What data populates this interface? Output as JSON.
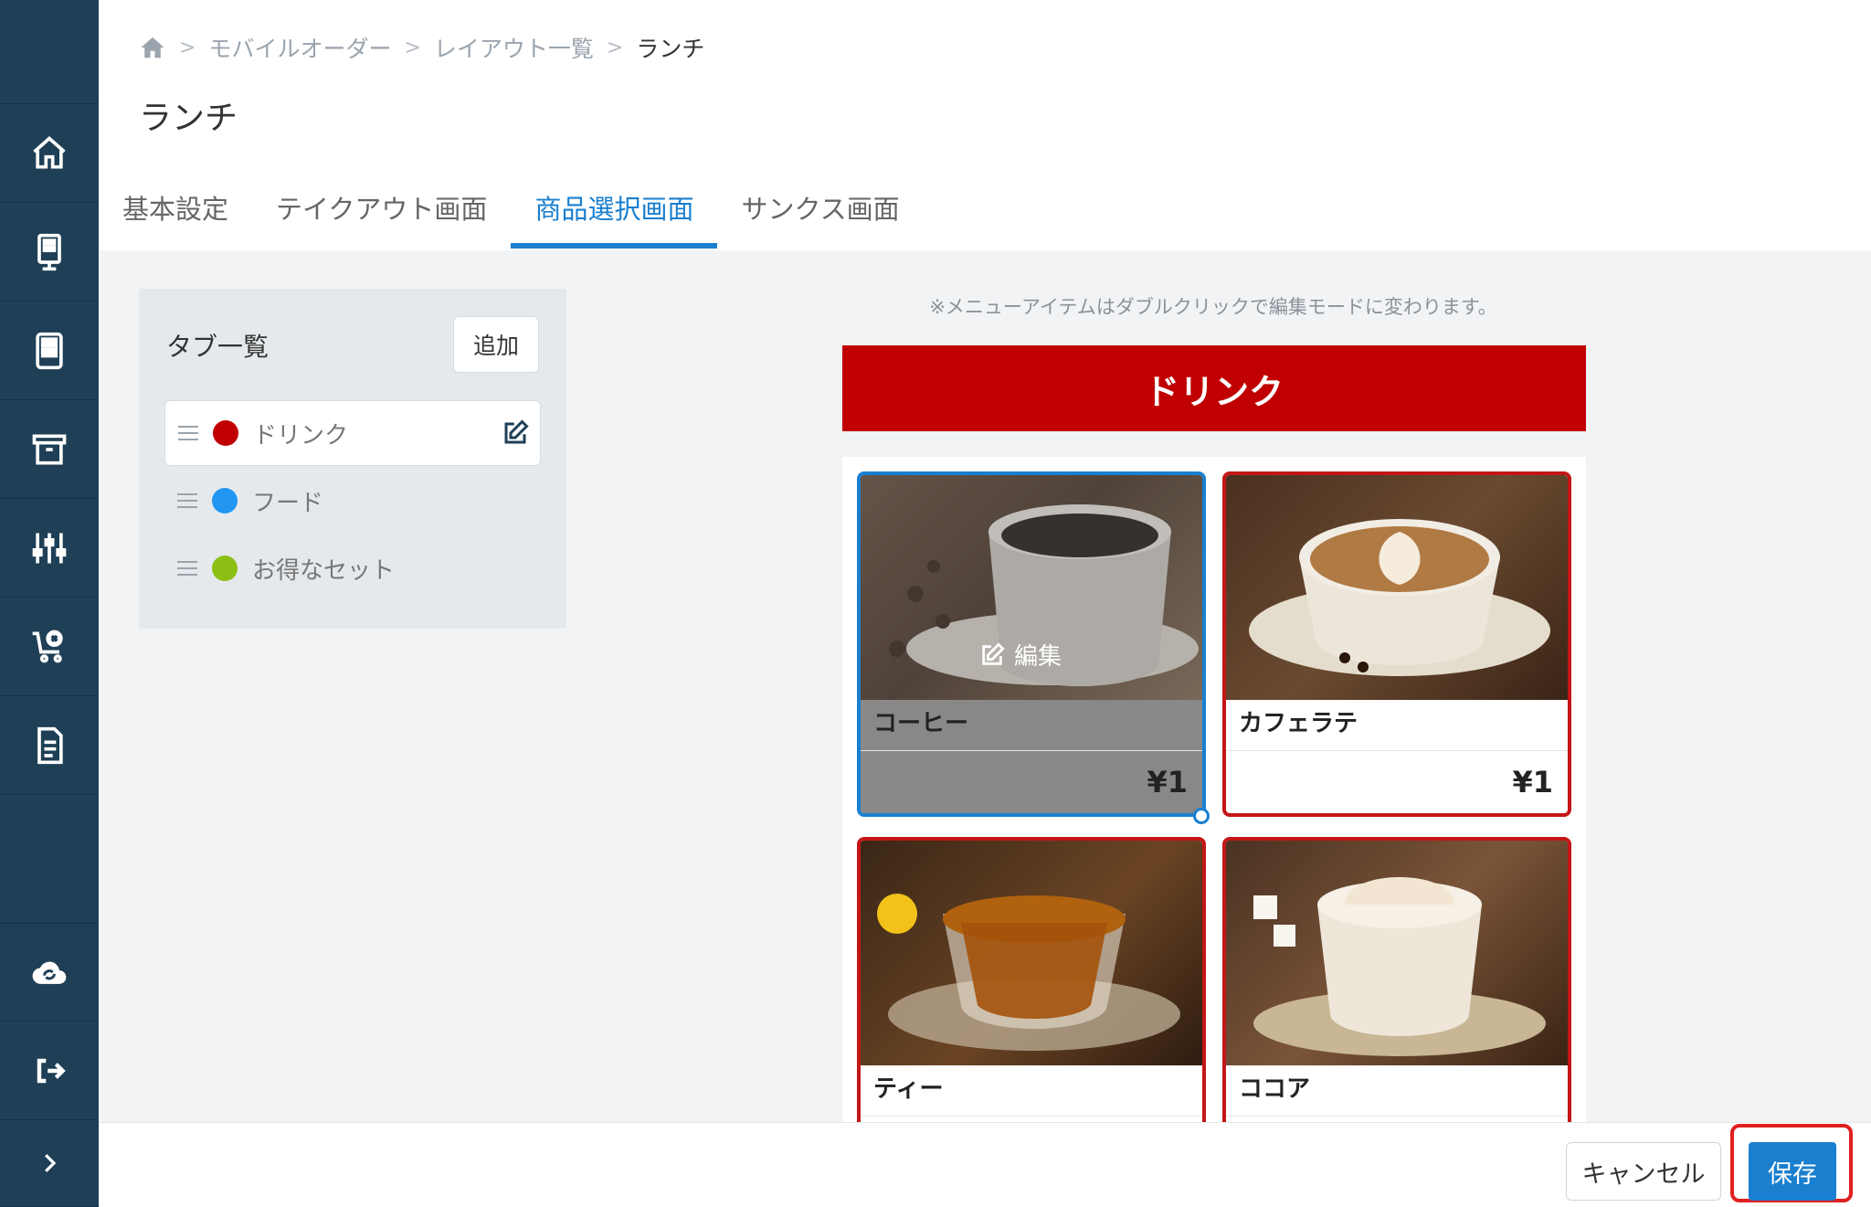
{
  "breadcrumb": [
    "モバイルオーダー",
    "レイアウト一覧",
    "ランチ"
  ],
  "page_title": "ランチ",
  "tabs": [
    {
      "label": "基本設定",
      "active": false
    },
    {
      "label": "テイクアウト画面",
      "active": false
    },
    {
      "label": "商品選択画面",
      "active": true
    },
    {
      "label": "サンクス画面",
      "active": false
    }
  ],
  "tab_list": {
    "title": "タブ一覧",
    "add_label": "追加",
    "items": [
      {
        "label": "ドリンク",
        "color": "#c00000"
      },
      {
        "label": "フード",
        "color": "#2196f3"
      },
      {
        "label": "お得なセット",
        "color": "#8cbf14"
      }
    ]
  },
  "preview": {
    "hint": "※メニューアイテムはダブルクリックで編集モードに変わります。",
    "banner": "ドリンク",
    "edit_overlay": "編集",
    "products": [
      {
        "name": "コーヒー",
        "price": "¥1"
      },
      {
        "name": "カフェラテ",
        "price": "¥1"
      },
      {
        "name": "ティー",
        "price": ""
      },
      {
        "name": "ココア",
        "price": ""
      }
    ]
  },
  "footer": {
    "cancel_label": "キャンセル",
    "save_label": "保存"
  },
  "colors": {
    "sidebar": "#1f3f56",
    "accent": "#1a7fcf",
    "banner": "#c00000",
    "highlight": "#e02020"
  },
  "sidebar_icons": [
    "home-icon",
    "kiosk-icon",
    "tablet-icon",
    "archive-icon",
    "sliders-icon",
    "cart-cancel-icon",
    "document-icon",
    "cloud-sync-icon",
    "logout-icon",
    "chevron-right-icon"
  ]
}
